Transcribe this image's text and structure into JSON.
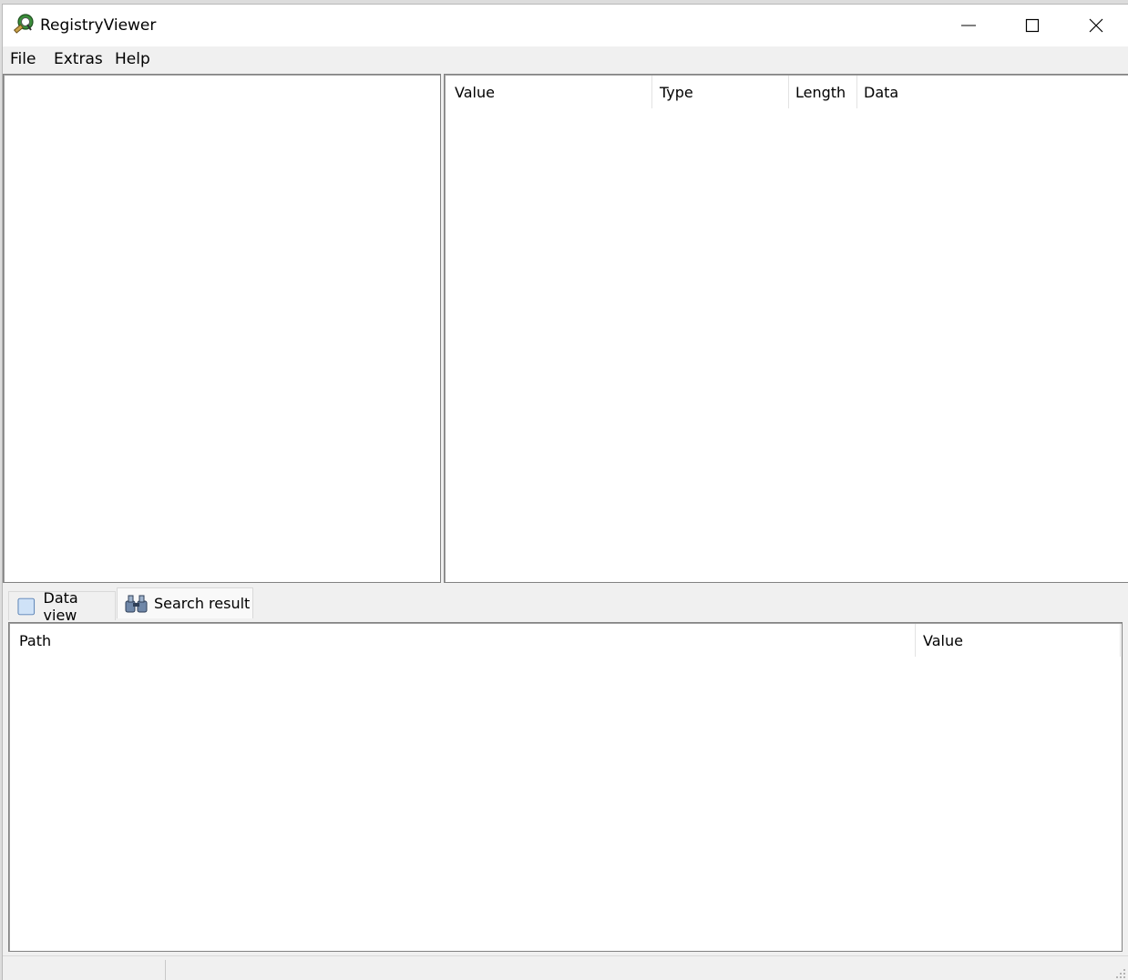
{
  "window": {
    "title": "RegistryViewer",
    "app_icon": "registry-viewer-icon"
  },
  "controls": {
    "minimize_icon": "minimize-icon",
    "maximize_icon": "maximize-icon",
    "close_icon": "close-icon"
  },
  "menu": {
    "file": "File",
    "extras": "Extras",
    "help": "Help"
  },
  "values_table": {
    "columns": [
      "Value",
      "Type",
      "Length",
      "Data"
    ],
    "rows": []
  },
  "tabs": [
    {
      "label": "Data view",
      "icon": "document-icon",
      "active": false
    },
    {
      "label": "Search result",
      "icon": "binoculars-icon",
      "active": true
    }
  ],
  "search_table": {
    "columns": [
      "Path",
      "Value"
    ],
    "rows": []
  },
  "tree": {
    "items": []
  }
}
